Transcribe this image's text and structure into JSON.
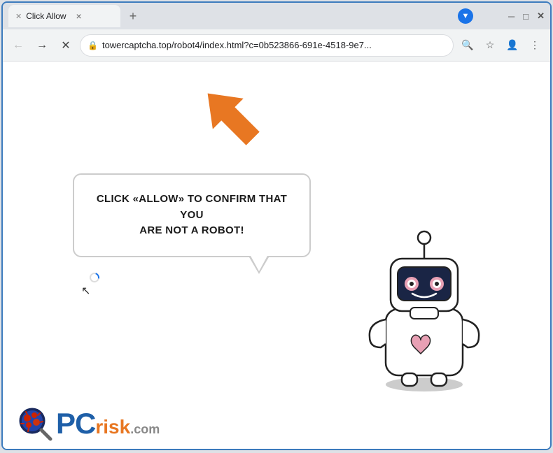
{
  "browser": {
    "tab": {
      "title": "Click Allow",
      "favicon": "✕"
    },
    "address": "towercaptcha.top/robot4/index.html?c=0b523866-691e-4518-9e7...",
    "window_controls": {
      "minimize": "─",
      "maximize": "□",
      "close": "✕"
    }
  },
  "page": {
    "bubble_line1": "CLICK «ALLOW» TO CONFIRM THAT YOU",
    "bubble_line2": "ARE NOT A ROBOT!",
    "arrow_label": "allow-arrow",
    "robot_label": "robot-illustration"
  },
  "logo": {
    "pc": "PC",
    "risk": "risk",
    "com": ".com"
  },
  "colors": {
    "accent_blue": "#1a73e8",
    "orange": "#e87722",
    "border": "#3c7bbd"
  }
}
